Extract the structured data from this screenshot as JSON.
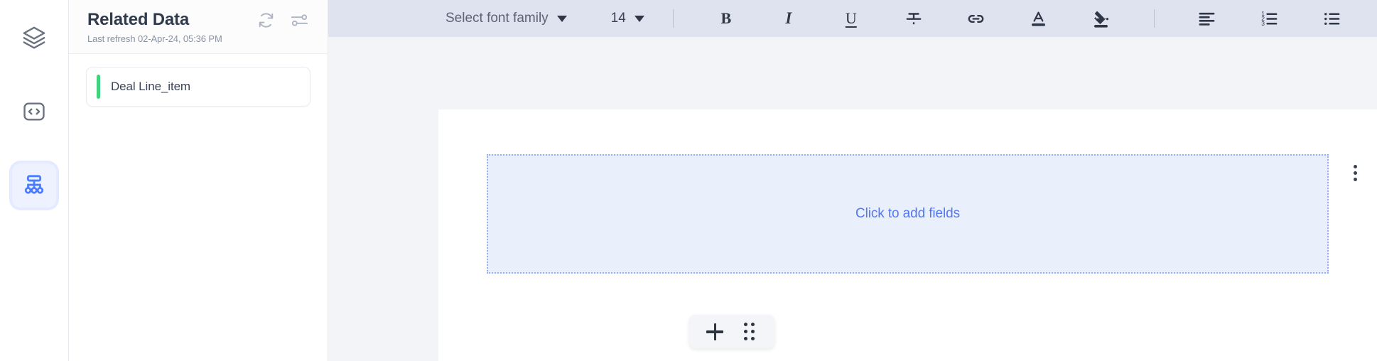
{
  "rail": {
    "items": [
      {
        "icon": "layers-icon",
        "name": "sidebar-item-layers",
        "active": false
      },
      {
        "icon": "code-icon",
        "name": "sidebar-item-code",
        "active": false
      },
      {
        "icon": "hierarchy-icon",
        "name": "sidebar-item-hierarchy",
        "active": true
      }
    ]
  },
  "panel": {
    "title": "Related Data",
    "subtitle": "Last refresh 02-Apr-24, 05:36 PM",
    "refresh_icon": "refresh-icon",
    "settings_icon": "sliders-icon",
    "accent_color": "#42d17f",
    "items": [
      {
        "label": "Deal Line_item"
      }
    ]
  },
  "toolbar": {
    "font_family_label": "Select font family",
    "font_size_label": "14",
    "bold_label": "B",
    "italic_label": "I",
    "underline_label": "U",
    "buttons": [
      {
        "name": "strikethrough-button",
        "icon": "strikethrough-icon"
      },
      {
        "name": "link-button",
        "icon": "link-icon"
      },
      {
        "name": "text-color-button",
        "icon": "text-color-icon"
      },
      {
        "name": "fill-color-button",
        "icon": "fill-color-icon"
      },
      {
        "name": "align-left-button",
        "icon": "align-left-icon"
      },
      {
        "name": "ordered-list-button",
        "icon": "ordered-list-icon"
      },
      {
        "name": "unordered-list-button",
        "icon": "unordered-list-icon"
      }
    ],
    "background_color": "#dfe3ef"
  },
  "canvas": {
    "dropzone_label": "Click to add fields",
    "dropzone_text_color": "#5578ef",
    "dropzone_fill_color": "#eaeffc",
    "dropzone_border_color": "#94aefc",
    "kebab_menu": "more-options-icon",
    "add_button": "add-icon",
    "drag_handle": "drag-handle-icon"
  }
}
